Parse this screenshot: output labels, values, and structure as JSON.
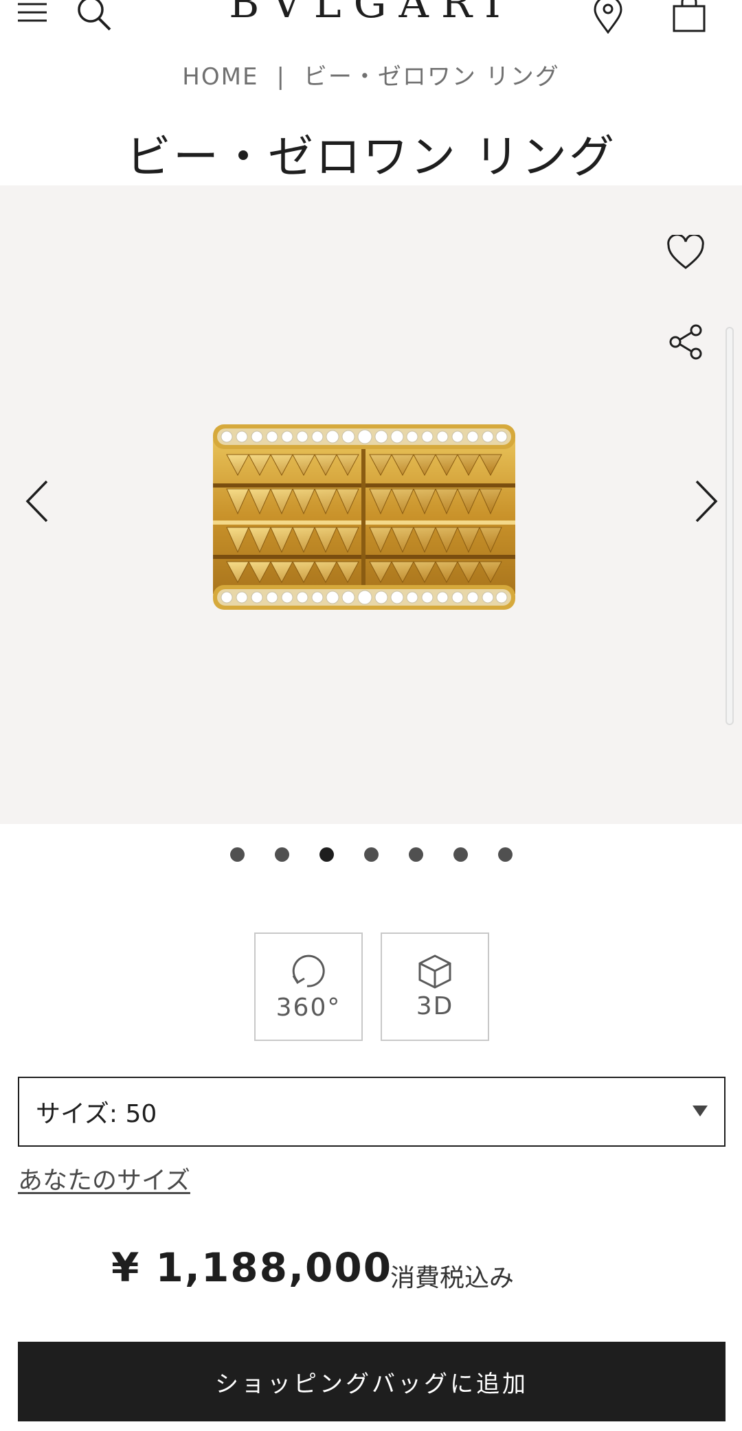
{
  "header": {
    "logo": "BVLGARI",
    "menu_icon": "hamburger-menu-icon",
    "search_icon": "search-icon",
    "store_icon": "location-pin-icon",
    "bag_icon": "shopping-bag-icon"
  },
  "breadcrumb": {
    "home": "HOME",
    "separator": "|",
    "current": "ビー・ゼロワン リング"
  },
  "product": {
    "title": "ビー・ゼロワン リング",
    "image_icon": "gold-studded-diamond-ring-image"
  },
  "gallery": {
    "wishlist_icon": "heart-icon",
    "share_icon": "share-icon",
    "prev_icon": "chevron-left-icon",
    "next_icon": "chevron-right-icon",
    "total_slides": 7,
    "active_slide": 3
  },
  "views": {
    "rotate_label": "360°",
    "rotate_icon": "rotate-360-icon",
    "model_label": "3D",
    "model_icon": "cube-icon"
  },
  "size": {
    "selected": "サイズ: 50",
    "dropdown_icon": "triangle-down-icon",
    "guide_link": "あなたのサイズ"
  },
  "pricing": {
    "price": "¥ 1,188,000",
    "tax_note": "消費税込み"
  },
  "cta": {
    "add_to_bag": "ショッピングバッグに追加"
  },
  "colors": {
    "text": "#1e1e1e",
    "gallery_bg": "#f5f3f2",
    "button_bg": "#1e1e1e",
    "gold": "#d9a93a"
  }
}
